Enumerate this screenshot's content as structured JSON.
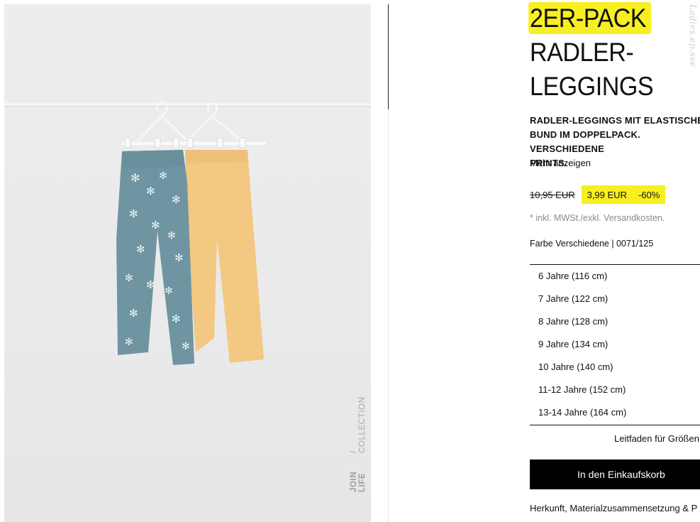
{
  "product": {
    "title_highlight": "2ER-PACK",
    "title_rest": "RADLER-\nLEGGINGS",
    "description": "RADLER-LEGGINGS MIT ELASTISCHEM\nBUND IM DOPPELPACK. VERSCHIEDENE\nPRINTS.",
    "more_link": "Mehr anzeigen",
    "old_price": "10,95 EUR",
    "new_price": "3,99 EUR",
    "discount": "-60%",
    "tax_note": "* inkl. MWSt./exkl. Versandkosten.",
    "color_line": "Farbe Verschiedene | 0071/125",
    "size_guide": "Leitfaden für Größen",
    "add_to_cart": "In den Einkaufskorb",
    "origin_link": "Herkunft, Materialzusammensetzung & P"
  },
  "sizes": [
    "6 Jahre (116 cm)",
    "7 Jahre (122 cm)",
    "8 Jahre (128 cm)",
    "9 Jahre (134 cm)",
    "10 Jahre (140 cm)",
    "11-12 Jahre (152 cm)",
    "13-14 Jahre (164 cm)"
  ],
  "image": {
    "brand_bold": "JOIN LIFE",
    "brand_rest": " / COLLECTION"
  },
  "watermark": "Ladies.ep.sse",
  "colors": {
    "highlight": "#f7ef22",
    "button": "#000000",
    "legging_blue": "#6f95a3",
    "legging_yellow": "#f3c883"
  }
}
